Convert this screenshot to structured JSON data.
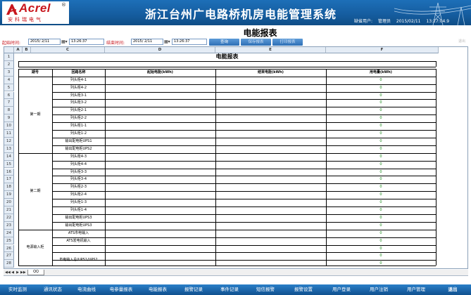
{
  "header": {
    "brand": "Acrel",
    "brand_sub": "安科瑞电气",
    "registered": "®",
    "title": "浙江台州广电路桥机房电能管理系统",
    "user_type": "缺省用户:",
    "user_name": "管理员",
    "date": "2015/02/11",
    "time": "13:27:04.9"
  },
  "page_title": "电能报表",
  "toolbar": {
    "start_label": "起始时间:",
    "start_date": "2015/ 2/11",
    "start_time": "13:26:37",
    "end_label": "结束时间:",
    "end_date": "2015/ 2/11",
    "end_time": "13:26:37",
    "query_button": "查询",
    "save_button": "保存报表",
    "print_button": "打印报表",
    "corner_text": "退出"
  },
  "sheet": {
    "columns": [
      "A",
      "B",
      "C",
      "D",
      "E",
      "F"
    ],
    "row_numbers": [
      "1",
      "2",
      "3",
      "4",
      "5",
      "6",
      "7",
      "8",
      "9",
      "10",
      "11",
      "12",
      "13",
      "14",
      "15",
      "16",
      "17",
      "18",
      "19",
      "20",
      "21",
      "22",
      "23",
      "24",
      "25",
      "26",
      "27",
      "28"
    ],
    "report_title": "电能报表",
    "headers": {
      "group": "期号",
      "circuit": "回路名称",
      "start": "起始电能(kWh)",
      "end": "结束电能(kWh)",
      "usage": "用电量(kWh)"
    },
    "groups": [
      {
        "label": "第一期"
      },
      {
        "label": "第二期"
      },
      {
        "label": "电源输入柜"
      }
    ],
    "circuits": [
      "列头柜4-1",
      "列头柜4-2",
      "列头柜3-1",
      "列头柜3-2",
      "列头柜2-1",
      "列头柜2-2",
      "列头柜1-1",
      "列头柜1-2",
      "输出配电柜UPS1",
      "输出配电柜UPS2",
      "列头柜4-3",
      "列头柜4-4",
      "列头柜3-3",
      "列头柜3-4",
      "列头柜2-3",
      "列头柜2-4",
      "列头柜1-3",
      "列头柜1-4",
      "输出配电柜UPS3",
      "输出配电柜UPS3",
      "ATS市电输入",
      "ATS发电机输入",
      "",
      "市电输入总/UPS1/UPS2"
    ],
    "usage_values": [
      "0",
      "0",
      "0",
      "0",
      "0",
      "0",
      "0",
      "0",
      "0",
      "0",
      "0",
      "0",
      "0",
      "0",
      "0",
      "0",
      "0",
      "0",
      "0",
      "0",
      "0",
      "0",
      "0",
      "0",
      "0"
    ]
  },
  "sheet_tab": {
    "name": "QQ",
    "nav": [
      "◀◀",
      "◀",
      "▶",
      "▶▶"
    ]
  },
  "bottom_nav": [
    "实时监测",
    "通讯状态",
    "电流曲线",
    "电参量报表",
    "电能报表",
    "报警记录",
    "事件记录",
    "短信报警",
    "报警设置",
    "用户登录",
    "用户注销",
    "用户管理",
    "退出"
  ]
}
